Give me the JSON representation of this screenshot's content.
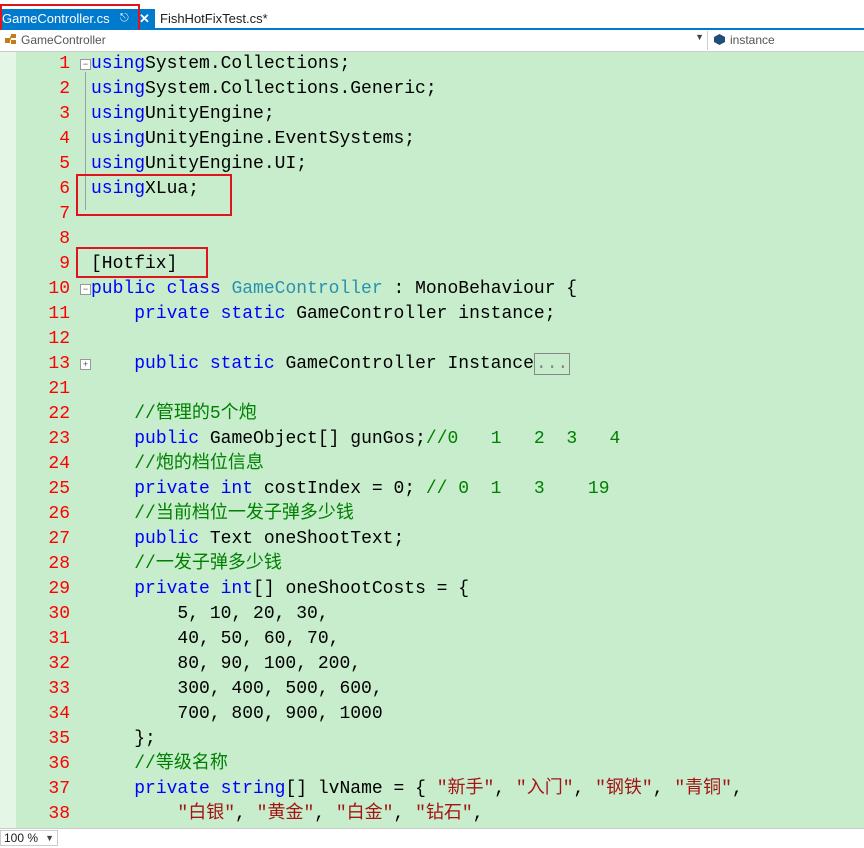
{
  "tabs": [
    {
      "label": "GameController.cs",
      "active": true
    },
    {
      "label": "FishHotFixTest.cs*",
      "active": false
    }
  ],
  "icons": {
    "pin": "pin-icon",
    "close": "close-icon"
  },
  "navbar": {
    "class_selector": "GameController",
    "member_selector": "instance"
  },
  "colors": {
    "editor_bg": "#c7edcc",
    "keyword": "#0000ff",
    "type": "#2b91af",
    "comment": "#008000",
    "string": "#a31515",
    "line_number": "#ff0000",
    "highlight_box": "#e0141e",
    "tab_active": "#007acc"
  },
  "editor": {
    "lines": [
      {
        "n": "1",
        "t": [
          [
            "kw",
            "using"
          ],
          [
            "",
            "System.Collections;"
          ]
        ],
        "fold": "minus"
      },
      {
        "n": "2",
        "t": [
          [
            "kw",
            "using"
          ],
          [
            "",
            "System.Collections.Generic;"
          ]
        ]
      },
      {
        "n": "3",
        "t": [
          [
            "kw",
            "using"
          ],
          [
            "",
            "UnityEngine;"
          ]
        ]
      },
      {
        "n": "4",
        "t": [
          [
            "kw",
            "using"
          ],
          [
            "",
            "UnityEngine.EventSystems;"
          ]
        ]
      },
      {
        "n": "5",
        "t": [
          [
            "kw",
            "using"
          ],
          [
            "",
            "UnityEngine.UI;"
          ]
        ]
      },
      {
        "n": "6",
        "t": [
          [
            "kw",
            "using"
          ],
          [
            "",
            "XLua;"
          ]
        ]
      },
      {
        "n": "7",
        "t": []
      },
      {
        "n": "8",
        "t": []
      },
      {
        "n": "9",
        "t": [
          [
            "",
            "[Hotfix]"
          ]
        ]
      },
      {
        "n": "10",
        "t": [
          [
            "kw",
            "public class "
          ],
          [
            "ty",
            "GameController"
          ],
          [
            "",
            " : MonoBehaviour {"
          ]
        ],
        "fold": "minus"
      },
      {
        "n": "11",
        "t": [
          [
            "",
            "    "
          ],
          [
            "kw",
            "private static "
          ],
          [
            "",
            "GameController instance;"
          ]
        ]
      },
      {
        "n": "12",
        "t": []
      },
      {
        "n": "13",
        "t": [
          [
            "",
            "    "
          ],
          [
            "kw",
            "public static "
          ],
          [
            "",
            "GameController Instance"
          ],
          [
            "collapsed",
            "..."
          ]
        ],
        "fold": "plus"
      },
      {
        "n": "21",
        "t": []
      },
      {
        "n": "22",
        "t": [
          [
            "",
            "    "
          ],
          [
            "cm",
            "//管理的5个炮"
          ]
        ]
      },
      {
        "n": "23",
        "t": [
          [
            "",
            "    "
          ],
          [
            "kw",
            "public "
          ],
          [
            "",
            "GameObject[] gunGos;"
          ],
          [
            "cm",
            "//0   1   2  3   4"
          ]
        ]
      },
      {
        "n": "24",
        "t": [
          [
            "",
            "    "
          ],
          [
            "cm",
            "//炮的档位信息"
          ]
        ]
      },
      {
        "n": "25",
        "t": [
          [
            "",
            "    "
          ],
          [
            "kw",
            "private int "
          ],
          [
            "",
            "costIndex = 0; "
          ],
          [
            "cm",
            "// 0  1   3    19"
          ]
        ]
      },
      {
        "n": "26",
        "t": [
          [
            "",
            "    "
          ],
          [
            "cm",
            "//当前档位一发子弹多少钱"
          ]
        ]
      },
      {
        "n": "27",
        "t": [
          [
            "",
            "    "
          ],
          [
            "kw",
            "public "
          ],
          [
            "",
            "Text oneShootText;"
          ]
        ]
      },
      {
        "n": "28",
        "t": [
          [
            "",
            "    "
          ],
          [
            "cm",
            "//一发子弹多少钱"
          ]
        ]
      },
      {
        "n": "29",
        "t": [
          [
            "",
            "    "
          ],
          [
            "kw",
            "private int"
          ],
          [
            "",
            "[] oneShootCosts = {"
          ]
        ]
      },
      {
        "n": "30",
        "t": [
          [
            "",
            "        5, 10, 20, 30,"
          ]
        ]
      },
      {
        "n": "31",
        "t": [
          [
            "",
            "        40, 50, 60, 70,"
          ]
        ]
      },
      {
        "n": "32",
        "t": [
          [
            "",
            "        80, 90, 100, 200,"
          ]
        ]
      },
      {
        "n": "33",
        "t": [
          [
            "",
            "        300, 400, 500, 600,"
          ]
        ]
      },
      {
        "n": "34",
        "t": [
          [
            "",
            "        700, 800, 900, 1000"
          ]
        ]
      },
      {
        "n": "35",
        "t": [
          [
            "",
            "    };"
          ]
        ]
      },
      {
        "n": "36",
        "t": [
          [
            "",
            "    "
          ],
          [
            "cm",
            "//等级名称"
          ]
        ]
      },
      {
        "n": "37",
        "t": [
          [
            "",
            "    "
          ],
          [
            "kw",
            "private string"
          ],
          [
            "",
            "[] lvName = { "
          ],
          [
            "st",
            "\"新手\""
          ],
          [
            "",
            ", "
          ],
          [
            "st",
            "\"入门\""
          ],
          [
            "",
            ", "
          ],
          [
            "st",
            "\"钢铁\""
          ],
          [
            "",
            ", "
          ],
          [
            "st",
            "\"青铜\""
          ],
          [
            "",
            ","
          ]
        ]
      },
      {
        "n": "38",
        "t": [
          [
            "",
            "        "
          ],
          [
            "st",
            "\"白银\""
          ],
          [
            "",
            ", "
          ],
          [
            "st",
            "\"黄金\""
          ],
          [
            "",
            ", "
          ],
          [
            "st",
            "\"白金\""
          ],
          [
            "",
            ", "
          ],
          [
            "st",
            "\"钻石\""
          ],
          [
            "",
            ","
          ]
        ]
      }
    ]
  },
  "statusbar": {
    "zoom": "100 %"
  }
}
